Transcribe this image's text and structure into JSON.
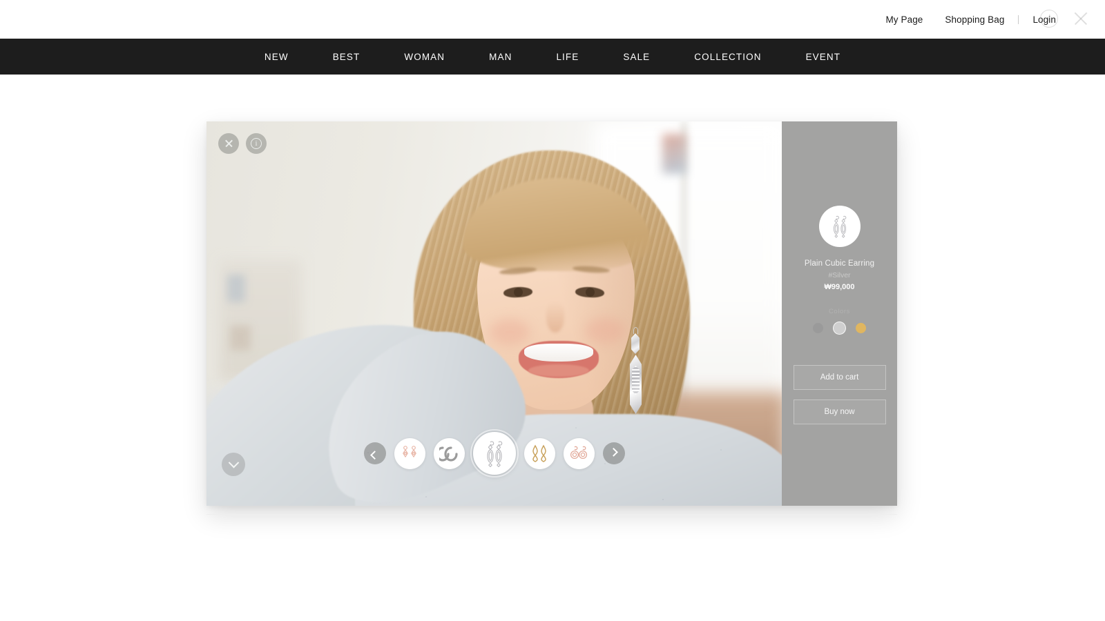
{
  "header": {
    "utility_links": [
      {
        "label": "My Page",
        "name": "my-page"
      },
      {
        "label": "Shopping Bag",
        "name": "shopping-bag"
      },
      {
        "label": "Login",
        "name": "login"
      }
    ],
    "overlay_icons": [
      {
        "name": "info-icon",
        "glyph": "i"
      },
      {
        "name": "close-icon",
        "glyph": "×"
      }
    ]
  },
  "nav": {
    "items": [
      {
        "label": "NEW"
      },
      {
        "label": "BEST"
      },
      {
        "label": "WOMAN"
      },
      {
        "label": "MAN"
      },
      {
        "label": "LIFE"
      },
      {
        "label": "SALE"
      },
      {
        "label": "COLLECTION"
      },
      {
        "label": "EVENT"
      }
    ]
  },
  "viewer": {
    "controls": {
      "close_label": "×",
      "info_label": "i",
      "scroll_down_label": "⌄"
    },
    "carousel": {
      "prev_label": "‹",
      "next_label": "›",
      "thumbs": [
        {
          "name": "thumb-rose-drop-earring",
          "style": "rose",
          "active": false
        },
        {
          "name": "thumb-silver-hoop-earring",
          "style": "hoop",
          "active": false
        },
        {
          "name": "thumb-plain-cubic-earring",
          "style": "cubic",
          "active": true
        },
        {
          "name": "thumb-gold-loop-earring",
          "style": "gold",
          "active": false
        },
        {
          "name": "thumb-rose-circle-earring",
          "style": "rosecircle",
          "active": false
        }
      ]
    }
  },
  "product": {
    "title": "Plain Cubic Earring",
    "tag": "#Silver",
    "price": "₩99,000",
    "colors_label": "Colors",
    "swatches": [
      {
        "name": "swatch-dark-gray",
        "color": "#9a9a9a",
        "selected": false
      },
      {
        "name": "swatch-silver",
        "color": "#cfcfcf",
        "selected": true
      },
      {
        "name": "swatch-gold",
        "color": "#e0b660",
        "selected": false
      }
    ],
    "add_to_cart_label": "Add to cart",
    "buy_now_label": "Buy now"
  }
}
